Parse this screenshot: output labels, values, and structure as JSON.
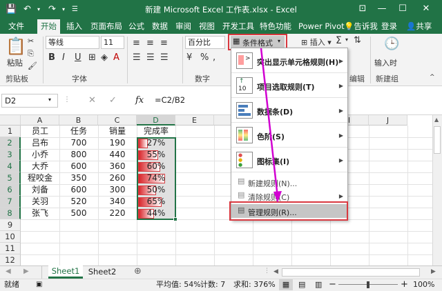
{
  "window": {
    "title": "新建 Microsoft Excel 工作表.xlsx - Excel"
  },
  "tabs": [
    "文件",
    "开始",
    "插入",
    "页面布局",
    "公式",
    "数据",
    "审阅",
    "视图",
    "开发工具",
    "特色功能",
    "Power Pivot"
  ],
  "tell": "告诉我",
  "login": "登录",
  "share": "共享",
  "ribbon": {
    "paste": "粘贴",
    "font_name": "等线",
    "font_size": "11",
    "number_format": "百分比",
    "cond_format": "条件格式",
    "insert": "插入",
    "edit": "编辑",
    "input_time": "输入时",
    "groups": {
      "clipboard": "剪贴板",
      "font": "字体",
      "number": "数字",
      "new_group": "新建组"
    }
  },
  "formula_bar": {
    "name_box": "D2",
    "fx": "fx",
    "formula": "=C2/B2"
  },
  "columns": [
    "A",
    "B",
    "C",
    "D",
    "E",
    "F",
    "G",
    "H",
    "I",
    "J"
  ],
  "rows": [
    "1",
    "2",
    "3",
    "4",
    "5",
    "6",
    "7",
    "8",
    "9",
    "10",
    "11",
    "12"
  ],
  "headers": [
    "员工",
    "任务",
    "销量",
    "完成率"
  ],
  "data": [
    {
      "name": "吕布",
      "task": "700",
      "sales": "190",
      "rate": "27%",
      "rate_value": 0.27
    },
    {
      "name": "小乔",
      "task": "800",
      "sales": "440",
      "rate": "55%",
      "rate_value": 0.55
    },
    {
      "name": "大乔",
      "task": "600",
      "sales": "360",
      "rate": "60%",
      "rate_value": 0.6
    },
    {
      "name": "程咬金",
      "task": "350",
      "sales": "260",
      "rate": "74%",
      "rate_value": 0.74
    },
    {
      "name": "刘备",
      "task": "600",
      "sales": "300",
      "rate": "50%",
      "rate_value": 0.5
    },
    {
      "name": "关羽",
      "task": "520",
      "sales": "340",
      "rate": "65%",
      "rate_value": 0.65
    },
    {
      "name": "张飞",
      "task": "500",
      "sales": "220",
      "rate": "44%",
      "rate_value": 0.44
    }
  ],
  "menu": {
    "highlight": "突出显示单元格规则(H)",
    "topbottom": "项目选取规则(T)",
    "databar": "数据条(D)",
    "colorscale": "色阶(S)",
    "iconset": "图标集(I)",
    "newrule": "新建规则(N)...",
    "clearrules": "清除规则(C)",
    "manage": "管理规则(R)...",
    "topbottom_icon": "10"
  },
  "sheets": [
    "Sheet1",
    "Sheet2"
  ],
  "status": {
    "ready": "就绪",
    "average": "平均值: 54%",
    "count": "计数: 7",
    "sum": "求和: 376%",
    "zoom": "100%"
  },
  "colors": {
    "excel_green": "#217346",
    "highlight_red": "#d9383f",
    "arrow_magenta": "#d100d1"
  }
}
